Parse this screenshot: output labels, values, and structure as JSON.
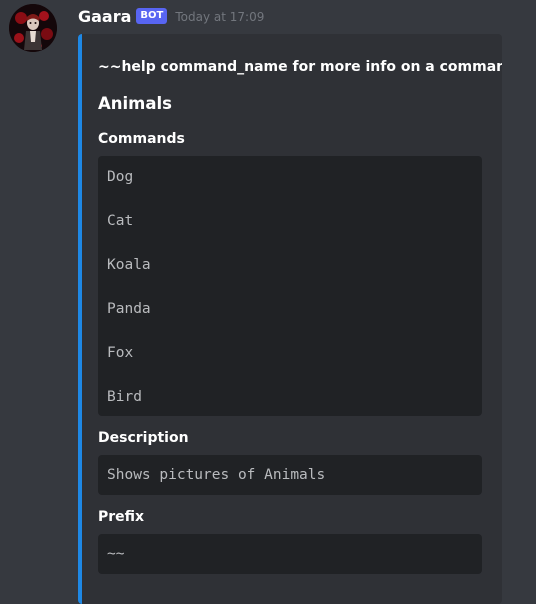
{
  "message": {
    "username": "Gaara",
    "badge": "BOT",
    "timestamp": "Today at 17:09"
  },
  "embed": {
    "description": "~~help command_name for more info on a command",
    "title": "Animals",
    "accent_color": "#1e88e5",
    "fields": [
      {
        "name": "Commands",
        "lines": [
          "Dog",
          "Cat",
          "Koala",
          "Panda",
          "Fox",
          "Bird"
        ]
      },
      {
        "name": "Description",
        "lines": [
          "Shows pictures of Animals"
        ]
      },
      {
        "name": "Prefix",
        "lines": [
          "~~"
        ]
      }
    ]
  }
}
